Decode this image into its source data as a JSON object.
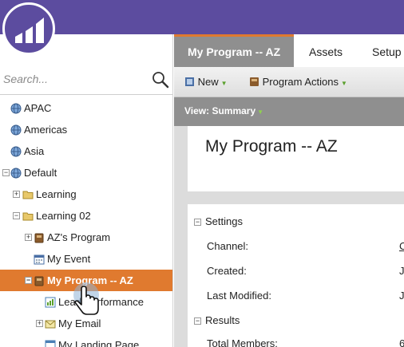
{
  "search": {
    "placeholder": "Search..."
  },
  "tree": [
    {
      "label": "APAC",
      "icon": "globe-icon"
    },
    {
      "label": "Americas",
      "icon": "globe-icon"
    },
    {
      "label": "Asia",
      "icon": "globe-icon"
    },
    {
      "label": "Default",
      "icon": "globe-icon",
      "expander": "−"
    },
    {
      "label": "Learning",
      "icon": "folder-icon",
      "expander": "+"
    },
    {
      "label": "Learning 02",
      "icon": "folder-icon",
      "expander": "−"
    },
    {
      "label": "AZ's Program",
      "icon": "program-icon",
      "expander": "+"
    },
    {
      "label": "My Event",
      "icon": "calendar-icon"
    },
    {
      "label": "My Program -- AZ",
      "icon": "program-icon",
      "expander": "−",
      "selected": true
    },
    {
      "label": "Lead Performance",
      "icon": "report-icon"
    },
    {
      "label": "My Email",
      "icon": "email-icon",
      "expander": "+"
    },
    {
      "label": "My Landing Page",
      "icon": "landing-page-icon"
    }
  ],
  "tabs": [
    "My Program -- AZ",
    "Assets",
    "Setup"
  ],
  "toolbar": {
    "new_label": "New",
    "program_actions_label": "Program Actions"
  },
  "view": {
    "label": "View: Summary"
  },
  "page_title": "My Program -- AZ",
  "sections": {
    "settings": "Settings",
    "results": "Results"
  },
  "fields": {
    "channel": "Channel:",
    "created": "Created:",
    "last_modified": "Last Modified:",
    "total_members": "Total Members:"
  },
  "values": {
    "channel": "C",
    "created": "J",
    "last_modified": "J",
    "total_members": "6"
  },
  "colors": {
    "brand": "#5c4c9f",
    "selected": "#e07a2f",
    "caret": "#5aa02c"
  }
}
